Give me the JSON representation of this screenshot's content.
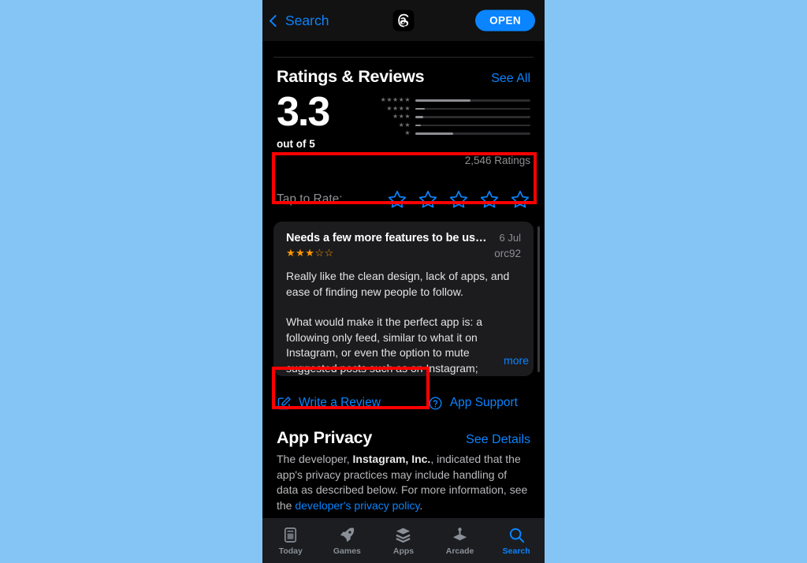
{
  "navbar": {
    "back_label": "Search",
    "app_icon": "threads-app-icon",
    "open_label": "OPEN"
  },
  "ratings": {
    "section_title": "Ratings & Reviews",
    "see_all_label": "See All",
    "score": "3.3",
    "out_of_label": "out of 5",
    "count_label": "2,546 Ratings",
    "histogram": [
      {
        "stars": "★★★★★",
        "percent": 48
      },
      {
        "stars": "★★★★",
        "percent": 8
      },
      {
        "stars": "★★★",
        "percent": 7
      },
      {
        "stars": "★★",
        "percent": 5
      },
      {
        "stars": "★",
        "percent": 33
      }
    ]
  },
  "tap_to_rate": {
    "label": "Tap to Rate:",
    "star_count": 5,
    "filled": 0
  },
  "review": {
    "title": "Needs a few more features to be us…",
    "date": "6 Jul",
    "author": "orc92",
    "rating": 3,
    "stars_display": "★★★☆☆",
    "paragraph_1": "Really like the clean design, lack of apps, and ease of finding new people to follow.",
    "paragraph_2": "What would make it the perfect app is: a following only feed, similar to what it on Instagram, or even the option to mute suggested posts such as on Instagram;",
    "more_label": "more"
  },
  "actions": {
    "write_review_label": "Write a Review",
    "write_review_icon": "pencil-square-icon",
    "app_support_label": "App Support",
    "app_support_icon": "question-circle-icon"
  },
  "privacy": {
    "section_title": "App Privacy",
    "see_details_label": "See Details",
    "text_part_1": "The developer, ",
    "developer_name": "Instagram, Inc.",
    "text_part_2": ", indicated that the app's privacy practices may include handling of data as described below. For more information, see the ",
    "link_label": "developer's privacy policy",
    "text_part_3": "."
  },
  "tabbar": {
    "tabs": [
      {
        "label": "Today",
        "icon": "today-cards-icon",
        "active": false
      },
      {
        "label": "Games",
        "icon": "rocket-icon",
        "active": false
      },
      {
        "label": "Apps",
        "icon": "stacked-layers-icon",
        "active": false
      },
      {
        "label": "Arcade",
        "icon": "joystick-icon",
        "active": false
      },
      {
        "label": "Search",
        "icon": "magnifier-icon",
        "active": true
      }
    ]
  },
  "annotations": {
    "highlight_color": "#ff0000",
    "boxes": [
      {
        "name": "tap-to-rate-highlight"
      },
      {
        "name": "write-a-review-highlight"
      }
    ]
  },
  "theme": {
    "background": "#85c5f5",
    "accent_blue": "#0a84ff",
    "star_orange": "#ff9500",
    "card_bg": "#1c1c1e"
  }
}
